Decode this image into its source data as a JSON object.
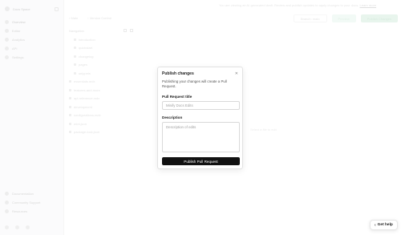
{
  "sidebar": {
    "workspace": "Docs Space",
    "nav": [
      "Overview",
      "Editor",
      "Analytics",
      "API",
      "Settings"
    ],
    "bottom": [
      "Documentation",
      "Community Support",
      "Resources"
    ]
  },
  "topbar": {
    "message": "You are viewing an AI-generated draft. Review and publish updates to apply changes to your docs.",
    "message_link": "Learn more",
    "tabs": [
      "Main",
      "Version Control"
    ],
    "actions": [
      "Branch: main",
      "Preview",
      "Publish Changes"
    ]
  },
  "filetree": {
    "heading": "Navigation",
    "items": [
      {
        "label": "introduction",
        "child": true
      },
      {
        "label": "quickstart",
        "child": true
      },
      {
        "label": "changelog",
        "child": true
      },
      {
        "label": "pages",
        "child": true
      },
      {
        "label": "snippets",
        "child": true
      },
      {
        "label": "essentials.mdx",
        "child": false
      },
      {
        "label": "features-and-more",
        "child": false
      },
      {
        "label": "api-reference.mdx",
        "child": false
      },
      {
        "label": "development",
        "child": false
      },
      {
        "label": "configurations.mdx",
        "child": false
      },
      {
        "label": "mint.json",
        "child": false
      },
      {
        "label": "package-lock.json",
        "child": false
      }
    ]
  },
  "main": {
    "empty_hint": "Select a file to edit"
  },
  "modal": {
    "title": "Publish changes",
    "close_icon": "close-icon",
    "description": "Publishing your changes will create a Pull Request.",
    "title_label": "Pull Request title",
    "title_placeholder": "Minify Docs Edits",
    "description_label": "Description",
    "description_placeholder": "Description of edits",
    "submit_label": "Publish Pull Request"
  },
  "help": {
    "label": "Get help",
    "icon": "chevron-left-icon"
  }
}
